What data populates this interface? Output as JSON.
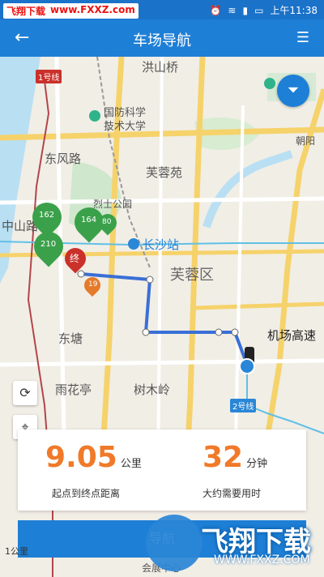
{
  "status": {
    "watermark": [
      "飞翔下载",
      "www.FXXZ.com"
    ],
    "time": "上午11:38",
    "icons": [
      "alarm-icon",
      "wifi-icon",
      "signal-icon",
      "battery-icon"
    ]
  },
  "appbar": {
    "title": "车场导航",
    "back_icon": "back-arrow-icon",
    "menu_icon": "list-menu-icon"
  },
  "map": {
    "labels": [
      {
        "text": "洪山桥"
      },
      {
        "text": "国防科学"
      },
      {
        "text": "技术大学"
      },
      {
        "text": "东风路"
      },
      {
        "text": "芙蓉苑"
      },
      {
        "text": "烈士公园"
      },
      {
        "text": "中山路"
      },
      {
        "text": "长沙站"
      },
      {
        "text": "芙蓉区"
      },
      {
        "text": "东塘"
      },
      {
        "text": "雨花亭"
      },
      {
        "text": "树木岭"
      },
      {
        "text": "机场高速"
      },
      {
        "text": "朝阳"
      },
      {
        "text": "会展中心"
      }
    ],
    "road_badges": [
      "1号线",
      "2号线"
    ],
    "markers": [
      {
        "label": "162",
        "color": "#3aa14a"
      },
      {
        "label": "164",
        "color": "#3aa14a"
      },
      {
        "label": "80",
        "color": "#3aa14a"
      },
      {
        "label": "210",
        "color": "#3aa14a"
      },
      {
        "label": "终",
        "color": "#c9312a"
      },
      {
        "label": "19",
        "color": "#e57a2a"
      }
    ]
  },
  "controls": {
    "filter_icon": "filter-icon",
    "refresh_icon": "refresh-icon",
    "locate_icon": "locate-icon"
  },
  "info": {
    "distance_value": "9.05",
    "distance_unit": "公里",
    "distance_label": "起点到终点距离",
    "time_value": "32",
    "time_unit": "分钟",
    "time_label": "大约需要用时"
  },
  "button": {
    "label": "导航"
  },
  "scale": {
    "text": "1公里"
  },
  "watermark_bottom": {
    "big": "飞翔下载",
    "small": "WWW.FXXZ.COM"
  },
  "colors": {
    "primary": "#1e7fd6",
    "accent": "#f07a2a",
    "green": "#3aa14a",
    "red": "#c9312a"
  }
}
